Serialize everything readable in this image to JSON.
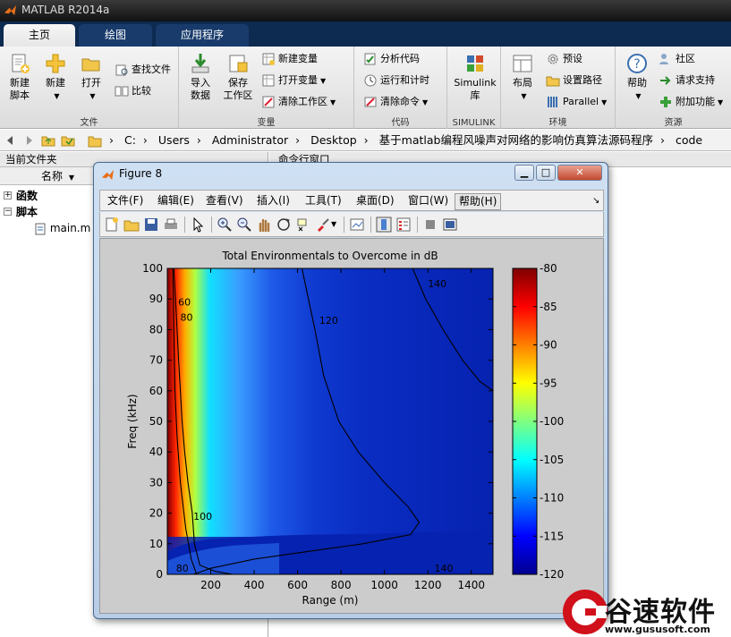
{
  "window": {
    "title": "MATLAB R2014a"
  },
  "tabs": [
    {
      "label": "主页"
    },
    {
      "label": "绘图"
    },
    {
      "label": "应用程序"
    }
  ],
  "ribbon": {
    "file": {
      "group": "文件",
      "new_script": "新建\n脚本",
      "new": "新建",
      "open": "打开",
      "find_files": "查找文件",
      "compare": "比较"
    },
    "variable": {
      "group": "变量",
      "import": "导入\n数据",
      "save_ws": "保存\n工作区",
      "new_var": "新建变量",
      "open_var": "打开变量",
      "clear_ws": "清除工作区"
    },
    "code": {
      "group": "代码",
      "analyze": "分析代码",
      "run_time": "运行和计时",
      "clear_cmd": "清除命令"
    },
    "simulink": {
      "group": "SIMULINK",
      "lib": "Simulink\n库"
    },
    "env": {
      "group": "环境",
      "layout": "布局",
      "prefs": "预设",
      "set_path": "设置路径",
      "parallel": "Parallel"
    },
    "resources": {
      "group": "资源",
      "help": "帮助",
      "community": "社区",
      "support": "请求支持",
      "addons": "附加功能"
    }
  },
  "address": {
    "crumbs": [
      "C:",
      "Users",
      "Administrator",
      "Desktop",
      "基于matlab编程风噪声对网络的影响仿真算法源码程序",
      "code"
    ]
  },
  "left_panel": {
    "title": "当前文件夹",
    "column": "名称",
    "items": [
      {
        "label": "函数",
        "expander": "+"
      },
      {
        "label": "脚本",
        "expander": "−"
      },
      {
        "label": "main.m"
      }
    ]
  },
  "right_panel": {
    "title": "命令行窗口"
  },
  "figure": {
    "title": "Figure 8",
    "menu": [
      "文件(F)",
      "编辑(E)",
      "查看(V)",
      "插入(I)",
      "工具(T)",
      "桌面(D)",
      "窗口(W)",
      "帮助(H)"
    ],
    "menu_arrow": "↘",
    "buttons": {
      "minimize": "▁",
      "maximize": "□",
      "close": "✕"
    }
  },
  "chart_data": {
    "type": "heatmap",
    "title": "Total Environmentals to Overcome in dB",
    "xlabel": "Range (m)",
    "ylabel": "Freq (kHz)",
    "xlim": [
      0,
      1500
    ],
    "ylim": [
      0,
      100
    ],
    "xticks": [
      200,
      400,
      600,
      800,
      1000,
      1200,
      1400
    ],
    "yticks": [
      0,
      10,
      20,
      30,
      40,
      50,
      60,
      70,
      80,
      90,
      100
    ],
    "colorbar": {
      "ticks": [
        -80,
        -85,
        -90,
        -95,
        -100,
        -105,
        -110,
        -115,
        -120
      ],
      "range": [
        -120,
        -80
      ],
      "colormap": "jet"
    },
    "contour_labels": [
      {
        "text": "60",
        "x": 50,
        "y": 89
      },
      {
        "text": "80",
        "x": 60,
        "y": 84
      },
      {
        "text": "120",
        "x": 700,
        "y": 83
      },
      {
        "text": "140",
        "x": 1200,
        "y": 95
      },
      {
        "text": "100",
        "x": 120,
        "y": 19
      },
      {
        "text": "80",
        "x": 40,
        "y": 2
      },
      {
        "text": "140",
        "x": 1230,
        "y": 2
      }
    ]
  },
  "watermark": {
    "brand": "谷速软件",
    "url": "www.gususoft.com"
  }
}
